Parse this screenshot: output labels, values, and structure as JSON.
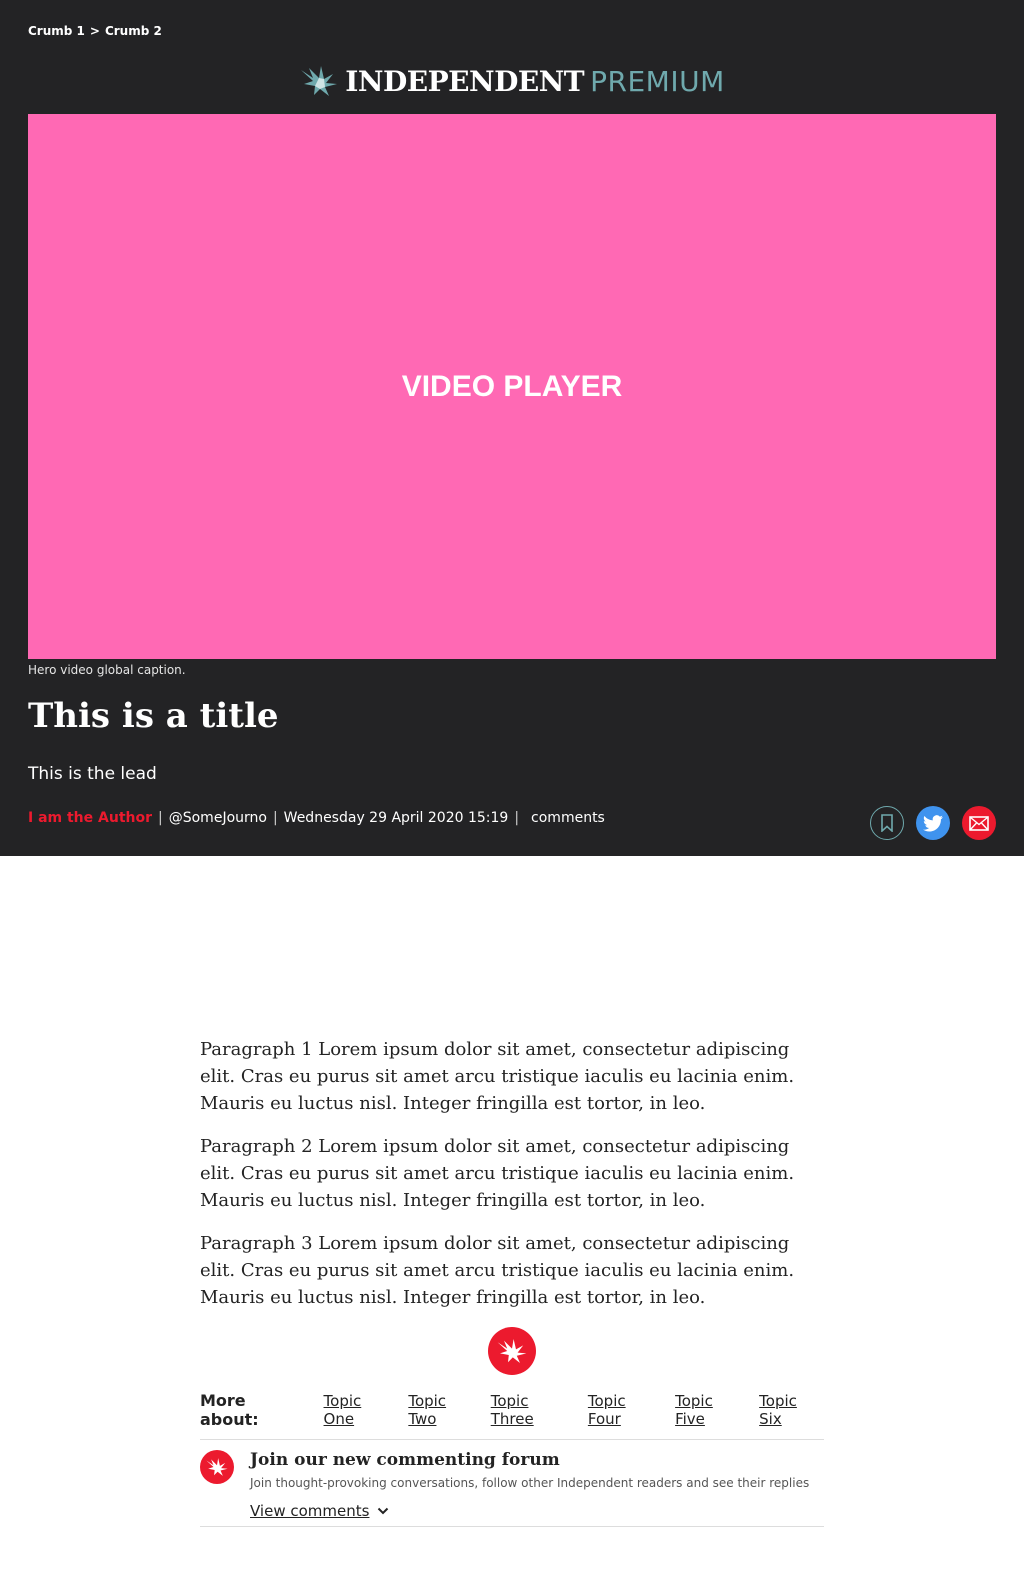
{
  "breadcrumb": {
    "crumb1": "Crumb 1",
    "separator": ">",
    "crumb2": "Crumb 2"
  },
  "masthead": {
    "brand": "INDEPENDENT",
    "tier": "PREMIUM"
  },
  "video": {
    "label": "VIDEO PLAYER",
    "background": "#ff69b4"
  },
  "caption": "Hero video global caption.",
  "article": {
    "title": "This is a title",
    "lead": "This is the lead",
    "author": "I am the Author",
    "handle": "@SomeJourno",
    "date": "Wednesday 29 April 2020 15:19",
    "comments": "comments",
    "paragraphs": [
      "Paragraph 1 Lorem ipsum dolor sit amet, consectetur adipiscing elit. Cras eu purus sit amet arcu tristique iaculis eu lacinia enim. Mauris eu luctus nisl. Integer fringilla est tortor, in leo.",
      "Paragraph 2 Lorem ipsum dolor sit amet, consectetur adipiscing elit. Cras eu purus sit amet arcu tristique iaculis eu lacinia enim. Mauris eu luctus nisl. Integer fringilla est tortor, in leo.",
      "Paragraph 3 Lorem ipsum dolor sit amet, consectetur adipiscing elit. Cras eu purus sit amet arcu tristique iaculis eu lacinia enim. Mauris eu luctus nisl. Integer fringilla est tortor, in leo."
    ]
  },
  "topics": {
    "label": "More about:",
    "items": [
      "Topic One",
      "Topic Two",
      "Topic Three",
      "Topic Four",
      "Topic Five",
      "Topic Six"
    ]
  },
  "forum": {
    "heading": "Join our new commenting forum",
    "description": "Join thought-provoking conversations, follow other Independent readers and see their replies",
    "view_label": "View comments"
  },
  "icons": {
    "bookmark": "bookmark-icon",
    "twitter": "twitter-icon",
    "email": "email-icon",
    "eagle": "eagle-logo-icon",
    "chevron": "chevron-down-icon"
  },
  "colors": {
    "hero_bg": "#232325",
    "accent_red": "#ec1a2e",
    "premium_teal": "#6fa9ad",
    "twitter_blue": "#3f93ee"
  }
}
